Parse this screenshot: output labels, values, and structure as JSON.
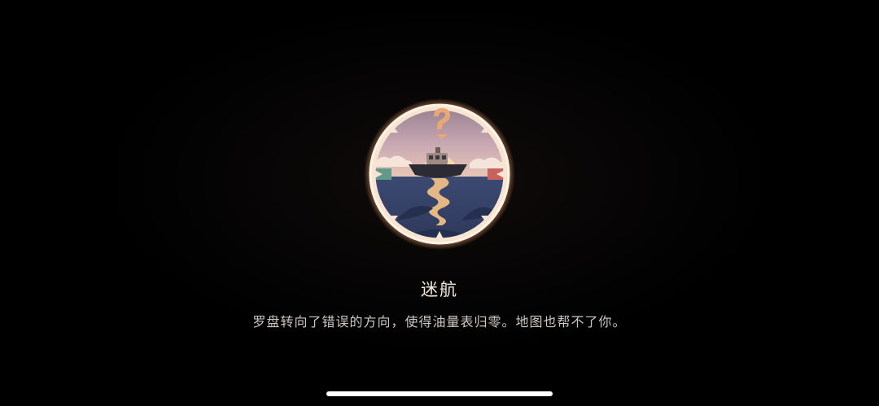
{
  "achievement": {
    "title": "迷航",
    "description": "罗盘转向了错误的方向，使得油量表归零。地图也帮不了你。",
    "badge_icon": "lost-at-sea-compass-badge",
    "glow_color": "#f2a36a"
  },
  "system": {
    "home_indicator_color": "#ffffff"
  }
}
